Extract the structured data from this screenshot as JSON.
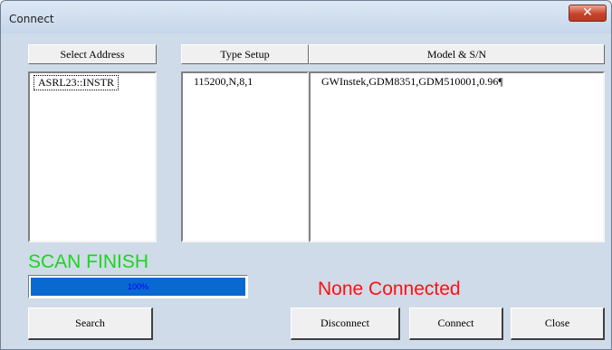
{
  "window": {
    "title": "Connect",
    "close_glyph": "✕"
  },
  "columns": {
    "address_header": "Select Address",
    "type_header": "Type Setup",
    "model_header": "Model & S/N"
  },
  "lists": {
    "addresses": [
      "ASRL23::INSTR"
    ],
    "types": [
      "115200,N,8,1"
    ],
    "models": [
      "GWInstek,GDM8351,GDM510001,0.96¶"
    ]
  },
  "scan": {
    "status_text": "SCAN FINISH",
    "color": "#1bd51b"
  },
  "progress": {
    "value_fraction": 1.0,
    "label": "100%",
    "fill_color": "#0969d1"
  },
  "connection": {
    "status_text": "None Connected",
    "color": "#ff1010"
  },
  "buttons": {
    "search": "Search",
    "disconnect": "Disconnect",
    "connect": "Connect",
    "close": "Close"
  }
}
